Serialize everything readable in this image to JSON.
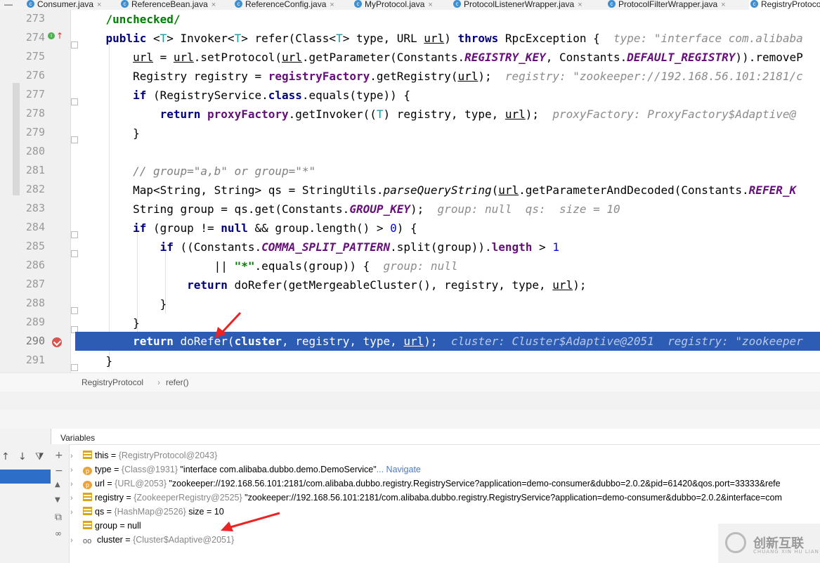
{
  "tabs": [
    {
      "label": "Consumer.java"
    },
    {
      "label": "ReferenceBean.java"
    },
    {
      "label": "ReferenceConfig.java"
    },
    {
      "label": "MyProtocol.java"
    },
    {
      "label": "ProtocolListenerWrapper.java"
    },
    {
      "label": "ProtocolFilterWrapper.java"
    },
    {
      "label": "RegistryProtocol.java"
    }
  ],
  "tab_close_glyph": "×",
  "tab_icon_glyph": "c",
  "line_numbers": [
    "273",
    "274",
    "275",
    "276",
    "277",
    "278",
    "279",
    "280",
    "281",
    "282",
    "283",
    "284",
    "285",
    "286",
    "287",
    "288",
    "289",
    "290",
    "291"
  ],
  "breadcrumb": {
    "class": "RegistryProtocol",
    "sep": "›",
    "method": "refer()"
  },
  "variables": {
    "title": "Variables",
    "items": [
      {
        "name": "this",
        "ref": "{RegistryProtocol@2043}",
        "value": ""
      },
      {
        "name": "type",
        "ref": "{Class@1931}",
        "value": "\"interface com.alibaba.dubbo.demo.DemoService\"",
        "extra": "... Navigate"
      },
      {
        "name": "url",
        "ref": "{URL@2053}",
        "value": "\"zookeeper://192.168.56.101:2181/com.alibaba.dubbo.registry.RegistryService?application=demo-consumer&dubbo=2.0.2&pid=61420&qos.port=33333&refe"
      },
      {
        "name": "registry",
        "ref": "{ZookeeperRegistry@2525}",
        "value": "\"zookeeper://192.168.56.101:2181/com.alibaba.dubbo.registry.RegistryService?application=demo-consumer&dubbo=2.0.2&interface=com"
      },
      {
        "name": "qs",
        "ref": "{HashMap@2526}",
        "value": " size = 10"
      },
      {
        "name": "group",
        "ref": "",
        "value": "null"
      },
      {
        "name": "cluster",
        "ref": "{Cluster$Adaptive@2051}",
        "value": ""
      }
    ]
  },
  "watermark": {
    "text": "创新互联",
    "sub": "CHUANG XIN HU LIAN"
  },
  "colors": {
    "selection": "#2d5cb5",
    "keyword": "#000080",
    "field": "#660e7a",
    "string": "#008000",
    "comment": "#808080",
    "arrow": "#ee2222"
  }
}
